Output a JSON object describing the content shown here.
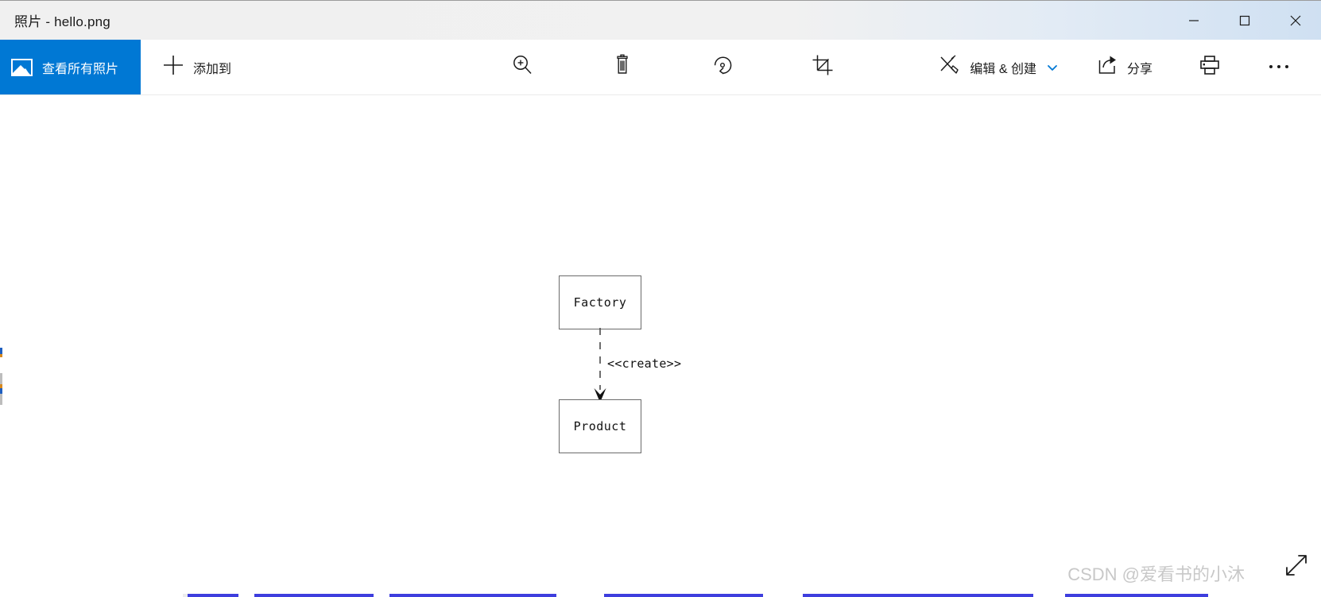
{
  "window": {
    "title": "照片 - hello.png",
    "controls": {
      "minimize": "minimize-label",
      "maximize": "maximize-label",
      "close": "close-label"
    }
  },
  "toolbar": {
    "view_all_label": "查看所有照片",
    "add_to_label": "添加到",
    "zoom_label": "zoom-in",
    "delete_label": "delete",
    "rotate_label": "rotate",
    "crop_label": "crop",
    "edit_create_label": "编辑 & 创建",
    "share_label": "分享",
    "print_label": "print",
    "more_label": "⋯",
    "accent_color": "#0078d4"
  },
  "diagram": {
    "type": "uml-class-diagram",
    "nodes": [
      {
        "id": "factory",
        "label": "Factory"
      },
      {
        "id": "product",
        "label": "Product"
      }
    ],
    "edges": [
      {
        "from": "factory",
        "to": "product",
        "stereotype": "<<create>>",
        "style": "dashed",
        "arrow": "filled-open"
      }
    ],
    "stroke_color": "#6b6b6b"
  },
  "watermark": {
    "text": "CSDN @爱看书的小沐"
  }
}
